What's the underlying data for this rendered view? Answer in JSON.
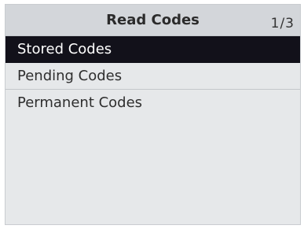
{
  "header": {
    "title": "Read Codes",
    "page_indicator": "1/3"
  },
  "menu": {
    "items": [
      {
        "label": "Stored Codes",
        "selected": true
      },
      {
        "label": "Pending Codes",
        "selected": false
      },
      {
        "label": "Permanent Codes",
        "selected": false
      }
    ]
  },
  "colors": {
    "screen_background": "#e6e8ea",
    "header_background": "#d3d6da",
    "selection_background": "#12111a",
    "selection_text": "#ffffff"
  }
}
